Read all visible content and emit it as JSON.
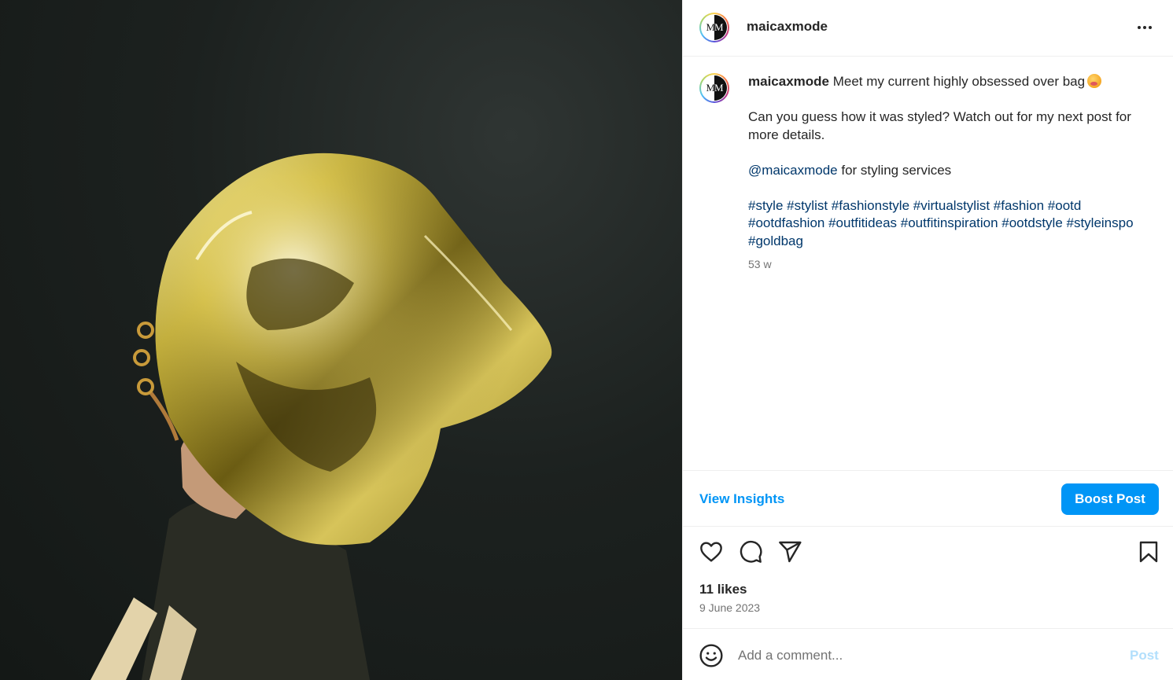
{
  "post": {
    "username": "maicaxmode",
    "avatar_monogram_left": "M",
    "avatar_monogram_right": "M",
    "more_icon": "more-horizontal-icon",
    "caption": {
      "username": "maicaxmode",
      "line1": "Meet my current highly obsessed over bag",
      "emoji": "face-with-hand-over-mouth-emoji",
      "line2": "Can you guess how it was styled? Watch out for my next post for more details.",
      "mention": "@maicaxmode",
      "mention_suffix": " for styling services",
      "hashtags": "#style #stylist #fashionstyle #virtualstylist #fashion #ootd #ootdfashion #outfitideas #outfitinspiration #ootdstyle #styleinspo #goldbag",
      "time_ago": "53 w"
    },
    "insights": {
      "view_insights_label": "View Insights",
      "boost_label": "Boost Post"
    },
    "actions": {
      "like_icon": "heart-icon",
      "comment_icon": "comment-icon",
      "share_icon": "share-icon",
      "save_icon": "bookmark-icon"
    },
    "likes_label": "11 likes",
    "date": "9 June 2023",
    "comment": {
      "emoji_icon": "smiley-icon",
      "placeholder": "Add a comment...",
      "value": "",
      "post_label": "Post"
    }
  },
  "colors": {
    "accent": "#0095f6",
    "link": "#00376b",
    "muted": "#737373",
    "post_disabled": "#b2dffc"
  }
}
